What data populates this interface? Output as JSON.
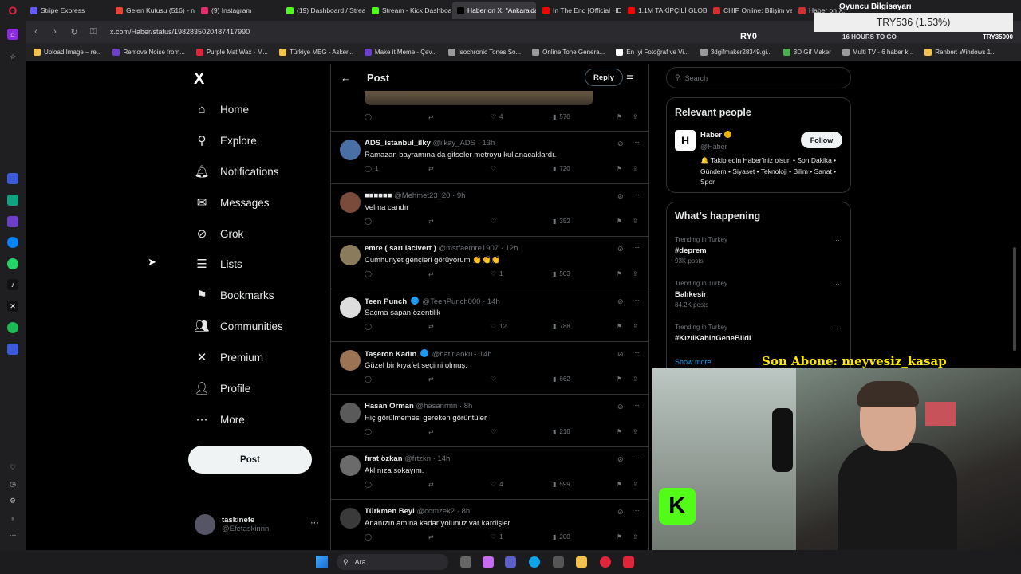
{
  "browser": {
    "tabs": [
      {
        "label": "Stripe Express",
        "color": "#635bff",
        "active": false
      },
      {
        "label": "Gelen Kutusu (516) - nor",
        "color": "#ea4335",
        "active": false
      },
      {
        "label": "(9) Instagram",
        "color": "#e1306c",
        "active": false
      },
      {
        "label": "(19) Dashboard / Stream",
        "color": "#53fc18",
        "active": false
      },
      {
        "label": "Stream - Kick Dashboard",
        "color": "#53fc18",
        "active": false
      },
      {
        "label": "Haber on X: \"Ankara'da C",
        "color": "#000000",
        "active": true
      },
      {
        "label": "In The End [Official HD M",
        "color": "#ff0000",
        "active": false
      },
      {
        "label": "1.1M TAKİPÇİLİ GLOBAL",
        "color": "#ff0000",
        "active": false
      },
      {
        "label": "CHIP Online: Bilişim ve T",
        "color": "#d32f2f",
        "active": false
      },
      {
        "label": "Haber on X:",
        "color": "#d32f2f",
        "active": false
      }
    ],
    "url": "x.com/Haber/status/1982835020487417990",
    "bookmarks": [
      "Upload Image – re...",
      "Remove Noise from...",
      "Purple Mat Wax - M...",
      "Türkiye MEG - Asker...",
      "Make it Meme - Çev...",
      "Isochronic Tones So...",
      "Online Tone Genera...",
      "En İyi Fotoğraf ve Vi...",
      "3dgifmaker28349.gi...",
      "3D Gif Maker",
      "Multi TV - 6 haber k...",
      "Rehber: Windows 1..."
    ]
  },
  "overlay": {
    "price": "TRY536 (1.53%)",
    "countdown": "16 HOURS TO GO",
    "ryo": "RY0",
    "try35": "TRY35000",
    "top_label": "Oyuncu Bilgisayarı",
    "abone": "Son Abone: meyvesiz_kasap",
    "kick_logo": "K"
  },
  "nav": {
    "logo": "X",
    "items": [
      {
        "label": "Home",
        "icon": "⌂"
      },
      {
        "label": "Explore",
        "icon": "⚲"
      },
      {
        "label": "Notifications",
        "icon": "🔔︎"
      },
      {
        "label": "Messages",
        "icon": "✉"
      },
      {
        "label": "Grok",
        "icon": "⊘"
      },
      {
        "label": "Lists",
        "icon": "☰"
      },
      {
        "label": "Bookmarks",
        "icon": "⚑"
      },
      {
        "label": "Communities",
        "icon": "👥︎"
      },
      {
        "label": "Premium",
        "icon": "✕"
      },
      {
        "label": "Profile",
        "icon": "👤︎"
      },
      {
        "label": "More",
        "icon": "⋯"
      }
    ],
    "post_button": "Post",
    "account": {
      "name": "taskinefe",
      "handle": "@Efetaskinnn"
    }
  },
  "post_header": {
    "back": "←",
    "title": "Post",
    "reply_button": "Reply"
  },
  "first_actions": {
    "likes": "4",
    "views": "570"
  },
  "tweets": [
    {
      "name": "ADS_istanbul_ilky",
      "handle": "@ilkay_ADS · 13h",
      "text": "Ramazan bayramına da gitseler metroyu kullanacaklardı.",
      "replies": "1",
      "likes": "",
      "views": "720",
      "verified": false,
      "avatar": "#4a6fa5"
    },
    {
      "name": "■■■■■■",
      "handle": "@Mehmet23_20 · 9h",
      "text": "Velma candır",
      "replies": "",
      "likes": "",
      "views": "352",
      "verified": false,
      "avatar": "#7a4b3a"
    },
    {
      "name": "emre ( sarı lacivert )",
      "handle": "@mstfaemre1907 · 12h",
      "text": "Cumhuriyet gençleri görüyorum 👏👏👏",
      "replies": "",
      "likes": "1",
      "views": "503",
      "verified": false,
      "avatar": "#8a7b5c"
    },
    {
      "name": "Teen Punch",
      "handle": "@TeenPunch000 · 14h",
      "text": "Saçma sapan özentilik",
      "replies": "",
      "likes": "12",
      "views": "788",
      "verified": true,
      "avatar": "#dddddd"
    },
    {
      "name": "Taşeron Kadın",
      "handle": "@hatirlaoku · 14h",
      "text": "Güzel bir kıyafet seçimi olmuş.",
      "replies": "",
      "likes": "",
      "views": "662",
      "verified": true,
      "avatar": "#9b7355"
    },
    {
      "name": "Hasan Orman",
      "handle": "@hasanrmn · 8h",
      "text": "Hiç görülmemesi gereken görüntüler",
      "replies": "",
      "likes": "",
      "views": "218",
      "verified": false,
      "avatar": "#5a5a5a"
    },
    {
      "name": "fırat özkan",
      "handle": "@frtzkn · 14h",
      "text": "Aklınıza sokayım.",
      "replies": "",
      "likes": "4",
      "views": "599",
      "verified": false,
      "avatar": "#6b6b6b"
    },
    {
      "name": "Türkmen Beyi",
      "handle": "@comzek2 · 8h",
      "text": "Ananızın amına kadar yolunuz var kardişler",
      "replies": "",
      "likes": "1",
      "views": "200",
      "verified": false,
      "avatar": "#3a3a3a"
    }
  ],
  "right": {
    "search_placeholder": "Search",
    "relevant_title": "Relevant people",
    "person": {
      "name": "Haber",
      "handle": "@Haber",
      "follow": "Follow",
      "avatar_letter": "H",
      "bio": "🔔 Takip edin Haber'iniz olsun • Son Dakika • Gündem • Siyaset • Teknoloji • Bilim • Sanat • Spor"
    },
    "happening_title": "What’s happening",
    "trends": [
      {
        "context": "Trending in Turkey",
        "name": "#deprem",
        "count": "93K posts"
      },
      {
        "context": "Trending in Turkey",
        "name": "Balıkesir",
        "count": "84.2K posts"
      },
      {
        "context": "Trending in Turkey",
        "name": "#KızılKahinGeneBildi",
        "count": ""
      }
    ],
    "show_more": "Show more"
  },
  "taskbar": {
    "search": "Ara"
  }
}
